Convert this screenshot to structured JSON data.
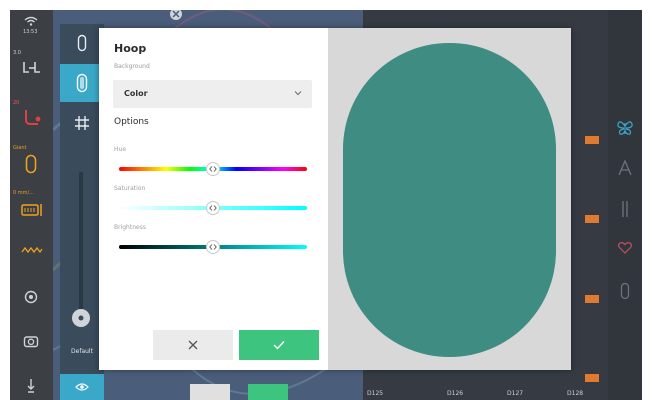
{
  "status": {
    "time": "13:53",
    "speed_value": "3.0",
    "hoop_size": "Giant",
    "stitch_length": "0 mm/..."
  },
  "toolbar": {
    "default_label": "Default"
  },
  "dialog": {
    "title": "Hoop",
    "background_label": "Background",
    "background_value": "Color",
    "options_label": "Options",
    "hue_label": "Hue",
    "saturation_label": "Saturation",
    "brightness_label": "Brightness",
    "hue_level": 0.5,
    "saturation_level": 0.5,
    "brightness_level": 0.5,
    "preview_color": "#3f8c83"
  },
  "thumbnails": {
    "labels": [
      "D125",
      "D126",
      "D127",
      "D128"
    ]
  },
  "colors": {
    "accent": "#3aa8c8",
    "confirm": "#3dc47e",
    "status_orange": "#f0a020"
  },
  "icons": {
    "wifi": "wifi-icon",
    "menu": "hamburger-menu-icon",
    "grid": "grid-icon",
    "hoop": "hoop-icon",
    "eye": "eye-icon",
    "cancel": "close-icon",
    "confirm": "checkmark-icon"
  }
}
